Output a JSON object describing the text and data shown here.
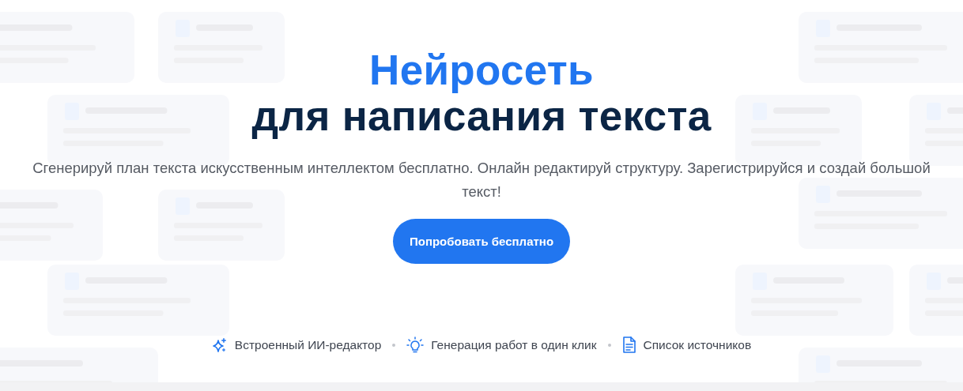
{
  "hero": {
    "title_accent": "Нейросеть",
    "title": "для написания текста",
    "subtitle": "Сгенерируй план текста искусственным интеллектом бесплатно. Онлайн редактируй структуру. Зарегистрируйся и создай большой текст!",
    "cta": "Попробовать бесплатно"
  },
  "features": [
    {
      "kind": "sparkle",
      "label": "Встроенный ИИ-редактор"
    },
    {
      "kind": "bulb",
      "label": "Генерация работ в один клик"
    },
    {
      "kind": "document",
      "label": "Список источников"
    }
  ]
}
